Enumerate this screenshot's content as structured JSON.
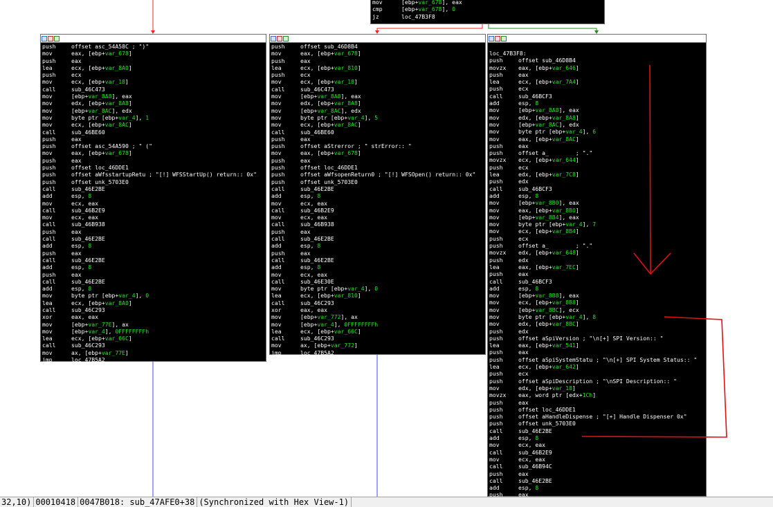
{
  "top_block": [
    [
      "mov",
      "[ebp+var_678], eax"
    ],
    [
      "cmp",
      "[ebp+var_678], 0"
    ],
    [
      "jz",
      "loc_47B3F8"
    ]
  ],
  "left_block": [
    [
      "push",
      "offset asc_54A58C ; \")\""
    ],
    [
      "mov",
      "eax, [ebp+var_678]"
    ],
    [
      "push",
      "eax"
    ],
    [
      "lea",
      "ecx, [ebp+var_8A0]"
    ],
    [
      "push",
      "ecx"
    ],
    [
      "mov",
      "ecx, [ebp+var_18]"
    ],
    [
      "call",
      "sub_46C473"
    ],
    [
      "mov",
      "[ebp+var_8A8], eax"
    ],
    [
      "mov",
      "edx, [ebp+var_8A8]"
    ],
    [
      "mov",
      "[ebp+var_8AC], edx"
    ],
    [
      "mov",
      "byte ptr [ebp+var_4], 1"
    ],
    [
      "mov",
      "ecx, [ebp+var_8AC]"
    ],
    [
      "call",
      "sub_46BE60"
    ],
    [
      "push",
      "eax"
    ],
    [
      "push",
      "offset asc_54A590 ; \" (\""
    ],
    [
      "mov",
      "eax, [ebp+var_678]"
    ],
    [
      "push",
      "eax"
    ],
    [
      "push",
      "offset loc_46DDE1"
    ],
    [
      "push",
      "offset aWfsstartupRetu ; \"[!] WFSStartUp() return:: 0x\""
    ],
    [
      "push",
      "offset unk_5703E0"
    ],
    [
      "call",
      "sub_46E2BE"
    ],
    [
      "add",
      "esp, 8"
    ],
    [
      "mov",
      "ecx, eax"
    ],
    [
      "call",
      "sub_46B2E9"
    ],
    [
      "mov",
      "ecx, eax"
    ],
    [
      "call",
      "sub_46B938"
    ],
    [
      "push",
      "eax"
    ],
    [
      "call",
      "sub_46E2BE"
    ],
    [
      "add",
      "esp, 8"
    ],
    [
      "push",
      "eax"
    ],
    [
      "call",
      "sub_46E2BE"
    ],
    [
      "add",
      "esp, 8"
    ],
    [
      "push",
      "eax"
    ],
    [
      "call",
      "sub_46E2BE"
    ],
    [
      "add",
      "esp, 8"
    ],
    [
      "mov",
      "byte ptr [ebp+var_4], 0"
    ],
    [
      "lea",
      "ecx, [ebp+var_8A0]"
    ],
    [
      "call",
      "sub_46C293"
    ],
    [
      "xor",
      "eax, eax"
    ],
    [
      "mov",
      "[ebp+var_77E], ax"
    ],
    [
      "mov",
      "[ebp+var_4], 0FFFFFFFFh"
    ],
    [
      "lea",
      "ecx, [ebp+var_66C]"
    ],
    [
      "call",
      "sub_46C293"
    ],
    [
      "mov",
      "ax, [ebp+var_77E]"
    ],
    [
      "jmp",
      "loc_47B5A2"
    ]
  ],
  "middle_block": [
    [
      "push",
      "offset sub_46D8B4"
    ],
    [
      "mov",
      "eax, [ebp+var_678]"
    ],
    [
      "push",
      "eax"
    ],
    [
      "lea",
      "ecx, [ebp+var_810]"
    ],
    [
      "push",
      "ecx"
    ],
    [
      "mov",
      "ecx, [ebp+var_18]"
    ],
    [
      "call",
      "sub_46C473"
    ],
    [
      "mov",
      "[ebp+var_8A8], eax"
    ],
    [
      "mov",
      "edx, [ebp+var_8A8]"
    ],
    [
      "mov",
      "[ebp+var_8AC], edx"
    ],
    [
      "mov",
      "byte ptr [ebp+var_4], 5"
    ],
    [
      "mov",
      "ecx, [ebp+var_8AC]"
    ],
    [
      "call",
      "sub_46BE60"
    ],
    [
      "push",
      "eax"
    ],
    [
      "push",
      "offset aStrerror ; \" strError:: \""
    ],
    [
      "mov",
      "eax, [ebp+var_678]"
    ],
    [
      "push",
      "eax"
    ],
    [
      "push",
      "offset loc_46DDE1"
    ],
    [
      "push",
      "offset aWfsopenReturn0 ; \"[!] WFSOpen() return:: 0x\""
    ],
    [
      "push",
      "offset unk_5703E0"
    ],
    [
      "call",
      "sub_46E2BE"
    ],
    [
      "add",
      "esp, 8"
    ],
    [
      "mov",
      "ecx, eax"
    ],
    [
      "call",
      "sub_46B2E9"
    ],
    [
      "mov",
      "ecx, eax"
    ],
    [
      "call",
      "sub_46B938"
    ],
    [
      "push",
      "eax"
    ],
    [
      "call",
      "sub_46E2BE"
    ],
    [
      "add",
      "esp, 8"
    ],
    [
      "push",
      "eax"
    ],
    [
      "call",
      "sub_46E2BE"
    ],
    [
      "add",
      "esp, 8"
    ],
    [
      "mov",
      "ecx, eax"
    ],
    [
      "call",
      "sub_46E30E"
    ],
    [
      "mov",
      "byte ptr [ebp+var_4], 0"
    ],
    [
      "lea",
      "ecx, [ebp+var_810]"
    ],
    [
      "call",
      "sub_46C293"
    ],
    [
      "xor",
      "eax, eax"
    ],
    [
      "mov",
      "[ebp+var_772], ax"
    ],
    [
      "mov",
      "[ebp+var_4], 0FFFFFFFFh"
    ],
    [
      "lea",
      "ecx, [ebp+var_66C]"
    ],
    [
      "call",
      "sub_46C293"
    ],
    [
      "mov",
      "ax, [ebp+var_772]"
    ],
    [
      "jmp",
      "loc_47B5A2"
    ]
  ],
  "right_block": [
    [
      "loc_47B3F8:",
      ""
    ],
    [
      "push",
      "offset sub_46D8B4"
    ],
    [
      "movzx",
      "eax, [ebp+var_646]"
    ],
    [
      "push",
      "eax"
    ],
    [
      "lea",
      "ecx, [ebp+var_7A4]"
    ],
    [
      "push",
      "ecx"
    ],
    [
      "call",
      "sub_46BCF3"
    ],
    [
      "add",
      "esp, 8"
    ],
    [
      "mov",
      "[ebp+var_8A8], eax"
    ],
    [
      "mov",
      "edx, [ebp+var_8A8]"
    ],
    [
      "mov",
      "[ebp+var_8AC], edx"
    ],
    [
      "mov",
      "byte ptr [ebp+var_4], 6"
    ],
    [
      "mov",
      "eax, [ebp+var_8AC]"
    ],
    [
      "push",
      "eax"
    ],
    [
      "push",
      "offset a_        ; \".\""
    ],
    [
      "movzx",
      "ecx, [ebp+var_644]"
    ],
    [
      "push",
      "ecx"
    ],
    [
      "lea",
      "edx, [ebp+var_7C8]"
    ],
    [
      "push",
      "edx"
    ],
    [
      "call",
      "sub_46BCF3"
    ],
    [
      "add",
      "esp, 8"
    ],
    [
      "mov",
      "[ebp+var_8B0], eax"
    ],
    [
      "mov",
      "eax, [ebp+var_8B0]"
    ],
    [
      "mov",
      "[ebp+var_8B4], eax"
    ],
    [
      "mov",
      "byte ptr [ebp+var_4], 7"
    ],
    [
      "mov",
      "ecx, [ebp+var_8B4]"
    ],
    [
      "push",
      "ecx"
    ],
    [
      "push",
      "offset a_        ; \".\""
    ],
    [
      "movzx",
      "edx, [ebp+var_648]"
    ],
    [
      "push",
      "edx"
    ],
    [
      "lea",
      "eax, [ebp+var_7EC]"
    ],
    [
      "push",
      "eax"
    ],
    [
      "call",
      "sub_46BCF3"
    ],
    [
      "add",
      "esp, 8"
    ],
    [
      "mov",
      "[ebp+var_8B8], eax"
    ],
    [
      "mov",
      "ecx, [ebp+var_8B8]"
    ],
    [
      "mov",
      "[ebp+var_8BC], ecx"
    ],
    [
      "mov",
      "byte ptr [ebp+var_4], 8"
    ],
    [
      "mov",
      "edx, [ebp+var_8BC]"
    ],
    [
      "push",
      "edx"
    ],
    [
      "push",
      "offset aSpiVersion ; \"\\n[+] SPI Version:: \""
    ],
    [
      "lea",
      "eax, [ebp+var_541]"
    ],
    [
      "push",
      "eax"
    ],
    [
      "push",
      "offset aSpiSystemStatu ; \"\\n[+] SPI System Status:: \""
    ],
    [
      "lea",
      "ecx, [ebp+var_642]"
    ],
    [
      "push",
      "ecx"
    ],
    [
      "push",
      "offset aSpiDescription ; \"\\nSPI Description:: \""
    ],
    [
      "mov",
      "edx, [ebp+var_18]"
    ],
    [
      "movzx",
      "eax, word ptr [edx+1Ch]"
    ],
    [
      "push",
      "eax"
    ],
    [
      "push",
      "offset loc_46DDE1"
    ],
    [
      "push",
      "offset aHandleDispense ; \"[+] Handle Dispenser 0x\""
    ],
    [
      "push",
      "offset unk_5703E0"
    ],
    [
      "call",
      "sub_46E2BE"
    ],
    [
      "add",
      "esp, 8"
    ],
    [
      "mov",
      "ecx, eax"
    ],
    [
      "call",
      "sub_46B2E9"
    ],
    [
      "mov",
      "ecx, eax"
    ],
    [
      "call",
      "sub_46B94C"
    ],
    [
      "push",
      "eax"
    ],
    [
      "call",
      "sub_46E2BE"
    ],
    [
      "add",
      "esp, 8"
    ],
    [
      "push",
      "eax"
    ]
  ],
  "status": {
    "seg1": "32,10)",
    "seg2": "00010418",
    "seg3": "0047B018: sub_47AFE0+38",
    "seg4": "(Synchronized with Hex View-1)"
  },
  "colors": {
    "true_edge": "#1f8a1f",
    "false_edge": "#ff2020",
    "flow_edge": "#4040ff",
    "annotation": "#e01010",
    "operand_highlight": "#22e322"
  }
}
